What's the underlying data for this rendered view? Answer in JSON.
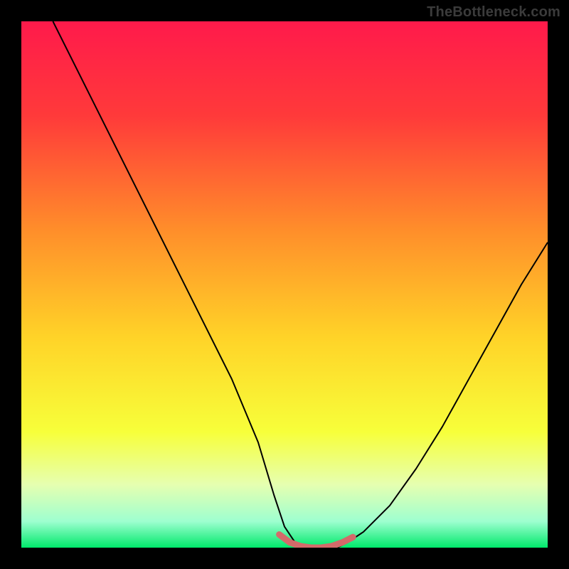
{
  "watermark": "TheBottleneck.com",
  "chart_data": {
    "type": "line",
    "title": "",
    "xlabel": "",
    "ylabel": "",
    "xlim": [
      0,
      100
    ],
    "ylim": [
      0,
      100
    ],
    "background_gradient": {
      "stops": [
        {
          "offset": 0.0,
          "color": "#ff1a4b"
        },
        {
          "offset": 0.18,
          "color": "#ff3a3a"
        },
        {
          "offset": 0.4,
          "color": "#ff8f2a"
        },
        {
          "offset": 0.6,
          "color": "#ffd328"
        },
        {
          "offset": 0.78,
          "color": "#f7ff3a"
        },
        {
          "offset": 0.88,
          "color": "#e6ffb0"
        },
        {
          "offset": 0.95,
          "color": "#9effd0"
        },
        {
          "offset": 1.0,
          "color": "#00e96b"
        }
      ]
    },
    "series": [
      {
        "name": "curve",
        "stroke": "#000000",
        "stroke_width": 2,
        "x": [
          6,
          10,
          15,
          20,
          25,
          30,
          35,
          40,
          45,
          48,
          50,
          52,
          55,
          57,
          60,
          62,
          65,
          70,
          75,
          80,
          85,
          90,
          95,
          100
        ],
        "y": [
          100,
          92,
          82,
          72,
          62,
          52,
          42,
          32,
          20,
          10,
          4,
          1,
          0,
          0,
          0,
          1,
          3,
          8,
          15,
          23,
          32,
          41,
          50,
          58
        ]
      },
      {
        "name": "highlight-band",
        "stroke": "#d46a6a",
        "stroke_width": 9,
        "linecap": "round",
        "x": [
          49,
          51,
          53,
          55,
          57,
          59,
          61,
          63
        ],
        "y": [
          2.5,
          1.0,
          0.3,
          0.0,
          0.0,
          0.3,
          1.0,
          2.0
        ]
      }
    ]
  }
}
